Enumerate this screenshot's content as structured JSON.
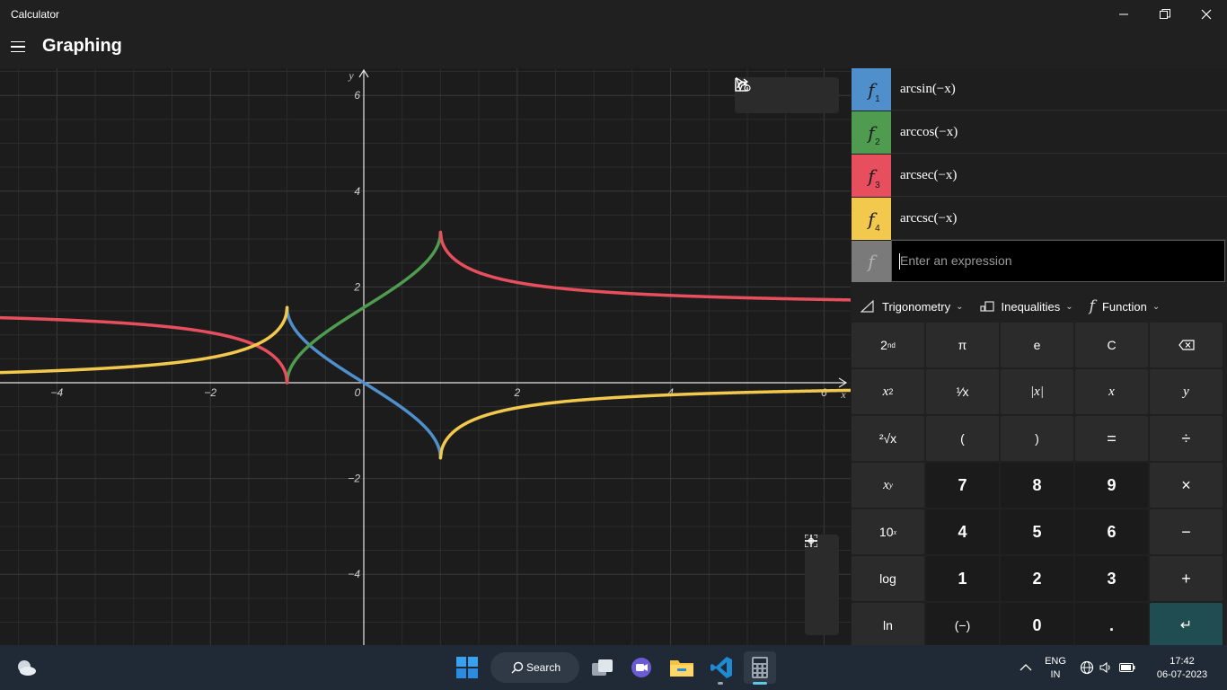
{
  "window": {
    "title": "Calculator",
    "minimize_icon": "minimize-icon",
    "maximize_icon": "restore-icon",
    "close_icon": "close-icon"
  },
  "header": {
    "menu_icon": "hamburger-icon",
    "title": "Graphing"
  },
  "graph": {
    "background": "#1c1c1c",
    "x_axis_label": "x",
    "y_axis_label": "y",
    "x_ticks": [
      "−4",
      "−2",
      "0",
      "2",
      "4",
      "6"
    ],
    "y_ticks": [
      "6",
      "4",
      "2",
      "−2",
      "−4"
    ],
    "toolbar": [
      "select-cursor-icon",
      "share-icon",
      "graph-options-icon"
    ],
    "zoom": [
      "zoom-in-icon",
      "zoom-out-icon",
      "reset-view-icon"
    ]
  },
  "chart_data": {
    "type": "line",
    "xlim": [
      -4.75,
      6.3
    ],
    "ylim": [
      -5.5,
      6.5
    ],
    "grid": true,
    "series": [
      {
        "name": "arcsin(−x)",
        "color": "#4f8fcb",
        "domain": [
          -1,
          1
        ]
      },
      {
        "name": "arccos(−x)",
        "color": "#4f9b4f",
        "domain": [
          -1,
          1
        ]
      },
      {
        "name": "arcsec(−x)",
        "color": "#e84f5e",
        "domain": "|x|>=1"
      },
      {
        "name": "arccsc(−x)",
        "color": "#f2c94c",
        "domain": "|x|>=1"
      }
    ]
  },
  "functions": [
    {
      "label": "f",
      "index": "1",
      "expr": "arcsin(−x)",
      "color": "#4f8fcb"
    },
    {
      "label": "f",
      "index": "2",
      "expr": "arccos(−x)",
      "color": "#4f9b4f"
    },
    {
      "label": "f",
      "index": "3",
      "expr": "arcsec(−x)",
      "color": "#e84f5e"
    },
    {
      "label": "f",
      "index": "4",
      "expr": "arccsc(−x)",
      "color": "#f2c94c"
    }
  ],
  "input": {
    "label": "f",
    "placeholder": "Enter an expression"
  },
  "categories": [
    {
      "label": "Trigonometry",
      "icon": "triangle-icon"
    },
    {
      "label": "Inequalities",
      "icon": "inequality-icon"
    },
    {
      "label": "Function",
      "icon": "function-icon"
    }
  ],
  "keys": {
    "second": "2",
    "second_sup": "nd",
    "pi": "π",
    "e": "e",
    "clear": "C",
    "backspace_icon": "backspace-icon",
    "x2": "x",
    "x2_sup": "2",
    "reciprocal": "¹⁄x",
    "abs": "|x|",
    "var_x": "x",
    "var_y": "y",
    "root": "²√x",
    "lparen": "(",
    "rparen": ")",
    "equals": "=",
    "divide": "÷",
    "xy": "x",
    "xy_sup": "y",
    "n7": "7",
    "n8": "8",
    "n9": "9",
    "multiply": "×",
    "ten": "10",
    "ten_sup": "x",
    "n4": "4",
    "n5": "5",
    "n6": "6",
    "minus": "−",
    "log": "log",
    "n1": "1",
    "n2": "2",
    "n3": "3",
    "plus": "+",
    "ln": "ln",
    "negate": "(−)",
    "n0": "0",
    "dot": ".",
    "enter": "↵"
  },
  "taskbar": {
    "search": "Search",
    "lang_line1": "ENG",
    "lang_line2": "IN",
    "time": "17:42",
    "date": "06-07-2023"
  }
}
